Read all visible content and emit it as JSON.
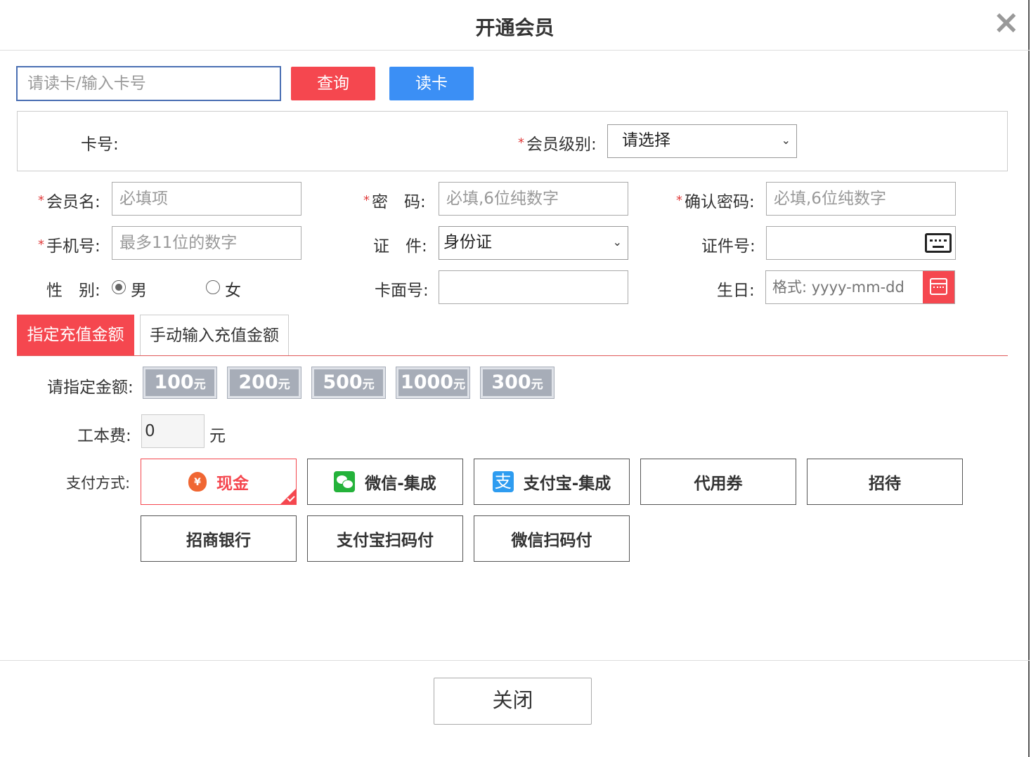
{
  "dialog": {
    "title": "开通会员",
    "close_icon": "×"
  },
  "search": {
    "placeholder": "请读卡/输入卡号",
    "query_label": "查询",
    "read_card_label": "读卡"
  },
  "card_box": {
    "card_no_label": "卡号:",
    "member_level_label": "会员级别:",
    "member_level_value": "请选择"
  },
  "form": {
    "member_name_label": "会员名:",
    "member_name_placeholder": "必填项",
    "password_label": "密　码:",
    "password_placeholder": "必填,6位纯数字",
    "confirm_password_label": "确认密码:",
    "confirm_password_placeholder": "必填,6位纯数字",
    "phone_label": "手机号:",
    "phone_placeholder": "最多11位的数字",
    "id_type_label": "证　件:",
    "id_type_value": "身份证",
    "id_number_label": "证件号:",
    "gender_label": "性　别:",
    "gender_male": "男",
    "gender_female": "女",
    "gender_selected": "男",
    "card_face_label": "卡面号:",
    "birthday_label": "生日:",
    "birthday_placeholder": "格式: yyyy-mm-dd",
    "required_mark": "*"
  },
  "tabs": [
    {
      "label": "指定充值金额",
      "active": true
    },
    {
      "label": "手动输入充值金额",
      "active": false
    }
  ],
  "amounts": {
    "label": "请指定金额:",
    "unit": "元",
    "items": [
      {
        "value": "100"
      },
      {
        "value": "200"
      },
      {
        "value": "500"
      },
      {
        "value": "1000"
      },
      {
        "value": "300"
      }
    ]
  },
  "fee": {
    "label": "工本费:",
    "value": "0",
    "unit": "元"
  },
  "payment": {
    "label": "支付方式:",
    "methods": [
      {
        "label": "现金",
        "icon": "money-bag-icon",
        "selected": true
      },
      {
        "label": "微信-集成",
        "icon": "wechat-icon"
      },
      {
        "label": "支付宝-集成",
        "icon": "alipay-icon"
      },
      {
        "label": "代用券"
      },
      {
        "label": "招待"
      },
      {
        "label": "招商银行"
      },
      {
        "label": "支付宝扫码付"
      },
      {
        "label": "微信扫码付"
      }
    ]
  },
  "footer": {
    "close_label": "关闭"
  },
  "colors": {
    "primary_red": "#f5474f",
    "primary_blue": "#3b8ff5",
    "amount_gray": "#a7adb8"
  }
}
